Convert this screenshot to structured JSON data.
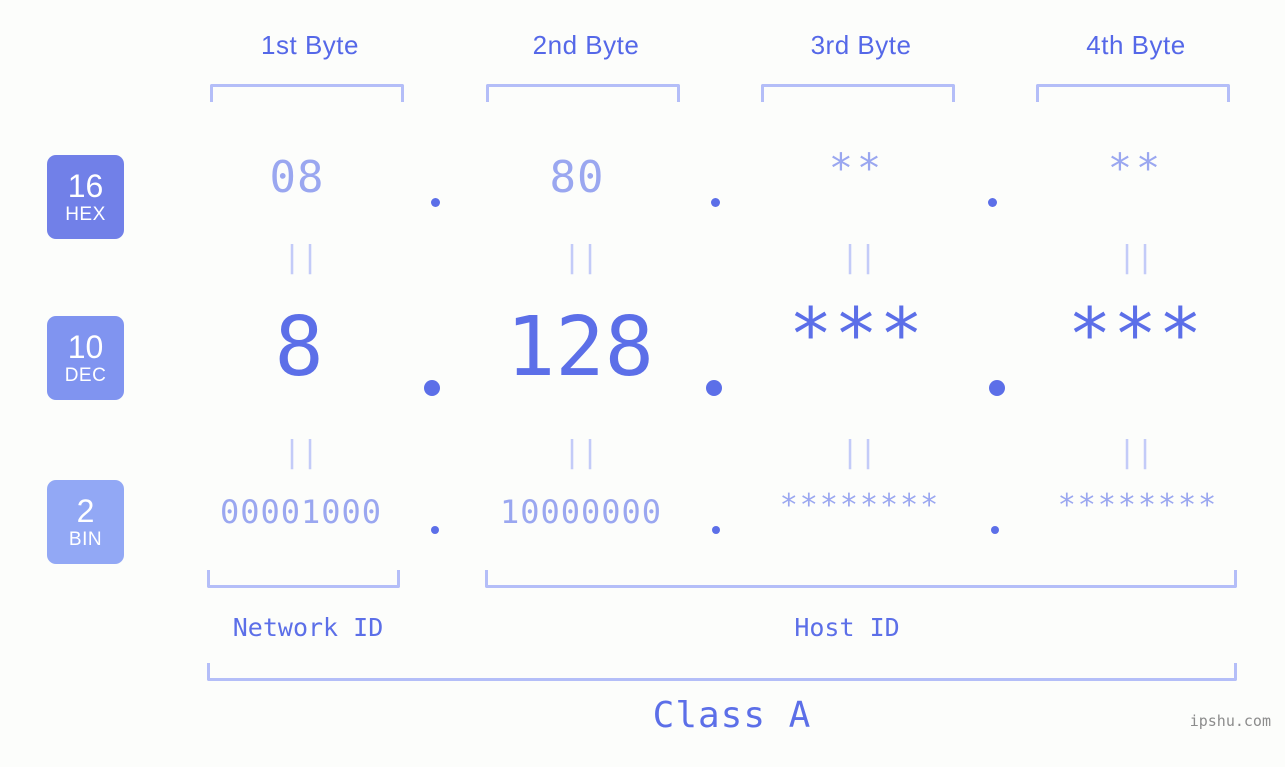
{
  "page": {
    "background_color": "#fcfdfb",
    "accent_color": "#5c6fe8",
    "accent_light_color": "#9aa7f0",
    "bracket_color": "#b4bef8",
    "watermark": "ipshu.com"
  },
  "byte_headers": [
    {
      "label": "1st Byte"
    },
    {
      "label": "2nd Byte"
    },
    {
      "label": "3rd Byte"
    },
    {
      "label": "4th Byte"
    }
  ],
  "bases": [
    {
      "number": "16",
      "abbr": "HEX",
      "color": "#7180e8"
    },
    {
      "number": "10",
      "abbr": "DEC",
      "color": "#8094f0"
    },
    {
      "number": "2",
      "abbr": "BIN",
      "color": "#92a8f5"
    }
  ],
  "rows": {
    "hex": {
      "values": [
        "08",
        "80",
        "**",
        "**"
      ]
    },
    "dec": {
      "values": [
        "8",
        "128",
        "***",
        "***"
      ]
    },
    "bin": {
      "values": [
        "00001000",
        "10000000",
        "********",
        "********"
      ]
    }
  },
  "separators": {
    "dot": ".",
    "equivalence": "||"
  },
  "sections": [
    {
      "label": "Network ID"
    },
    {
      "label": "Host ID"
    }
  ],
  "class": {
    "label": "Class A"
  }
}
